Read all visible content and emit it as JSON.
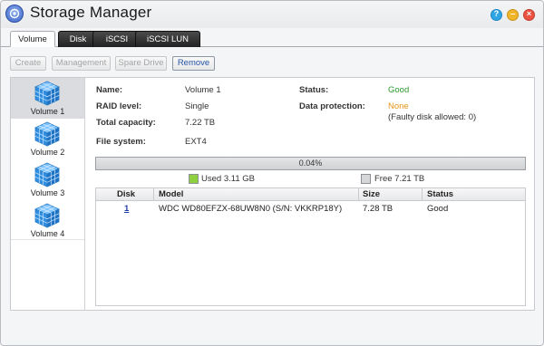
{
  "window": {
    "title": "Storage Manager",
    "icon": "storage-manager-icon",
    "controls": {
      "help": "?",
      "minimize": "–",
      "close": "×"
    }
  },
  "tabs": [
    {
      "label": "Volume",
      "active": true
    },
    {
      "label": "Disk",
      "active": false
    },
    {
      "label": "iSCSI",
      "active": false
    },
    {
      "label": "iSCSI LUN",
      "active": false
    }
  ],
  "toolbar": {
    "create": "Create",
    "management": "Management",
    "spare_drive": "Spare Drive",
    "remove": "Remove"
  },
  "volumes": [
    {
      "label": "Volume 1",
      "selected": true
    },
    {
      "label": "Volume 2",
      "selected": false
    },
    {
      "label": "Volume 3",
      "selected": false
    },
    {
      "label": "Volume 4",
      "selected": false
    }
  ],
  "details": {
    "name_label": "Name:",
    "name_value": "Volume 1",
    "raid_label": "RAID level:",
    "raid_value": "Single",
    "capacity_label": "Total capacity:",
    "capacity_value": "7.22 TB",
    "fs_label": "File system:",
    "fs_value": "EXT4",
    "status_label": "Status:",
    "status_value": "Good",
    "protection_label": "Data protection:",
    "protection_value": "None",
    "protection_note": "(Faulty disk allowed: 0)"
  },
  "usage": {
    "percent_text": "0.04%",
    "used_fraction": 0.0004,
    "used_label": "Used 3.11 GB",
    "free_label": "Free 7.21 TB",
    "used_color": "#8fd040",
    "free_color": "#d6d7d9"
  },
  "disk_table": {
    "headers": {
      "disk": "Disk",
      "model": "Model",
      "size": "Size",
      "status": "Status"
    },
    "rows": [
      {
        "disk": "1",
        "model": "WDC WD80EFZX-68UW8N0 (S/N: VKKRP18Y)",
        "size": "7.28 TB",
        "status": "Good"
      }
    ]
  },
  "colors": {
    "good": "#2c9a2c",
    "warning": "#e7961b",
    "link": "#1d3ea8"
  }
}
